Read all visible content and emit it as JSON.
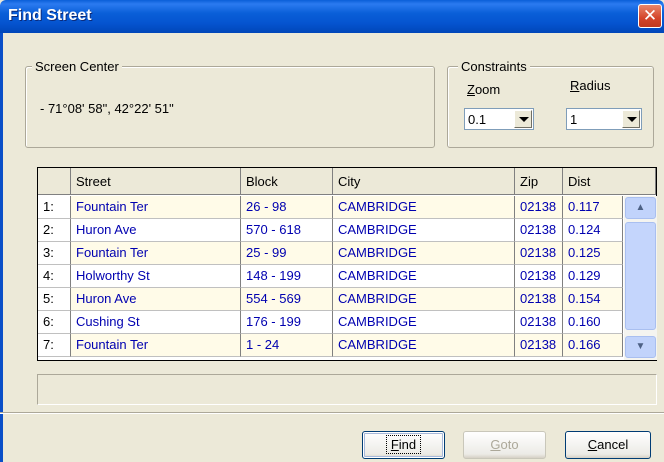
{
  "window": {
    "title": "Find Street",
    "close_glyph": "✕"
  },
  "screen_center": {
    "legend": "Screen Center",
    "coordinates": "- 71°08' 58\",  42°22' 51\""
  },
  "constraints": {
    "legend": "Constraints",
    "zoom": {
      "label_prefix": "Z",
      "label_rest": "oom",
      "value": "0.1"
    },
    "radius": {
      "label_prefix": "R",
      "label_rest": "adius",
      "value": "1"
    }
  },
  "results": {
    "columns": [
      "",
      "Street",
      "Block",
      "City",
      "Zip",
      "Dist"
    ],
    "rows": [
      {
        "idx": "1:",
        "street": "Fountain Ter",
        "block": "26 - 98",
        "city": "CAMBRIDGE",
        "zip": "02138",
        "dist": "0.117"
      },
      {
        "idx": "2:",
        "street": "Huron Ave",
        "block": "570 - 618",
        "city": "CAMBRIDGE",
        "zip": "02138",
        "dist": "0.124"
      },
      {
        "idx": "3:",
        "street": "Fountain Ter",
        "block": "25 - 99",
        "city": "CAMBRIDGE",
        "zip": "02138",
        "dist": "0.125"
      },
      {
        "idx": "4:",
        "street": "Holworthy St",
        "block": "148 - 199",
        "city": "CAMBRIDGE",
        "zip": "02138",
        "dist": "0.129"
      },
      {
        "idx": "5:",
        "street": "Huron Ave",
        "block": "554 - 569",
        "city": "CAMBRIDGE",
        "zip": "02138",
        "dist": "0.154"
      },
      {
        "idx": "6:",
        "street": "Cushing St",
        "block": "176 - 199",
        "city": "CAMBRIDGE",
        "zip": "02138",
        "dist": "0.160"
      },
      {
        "idx": "7:",
        "street": "Fountain Ter",
        "block": "1 - 24",
        "city": "CAMBRIDGE",
        "zip": "02138",
        "dist": "0.166"
      }
    ]
  },
  "buttons": {
    "find": {
      "prefix": "F",
      "rest": "ind"
    },
    "goto": {
      "prefix": "G",
      "rest": "oto"
    },
    "cancel": {
      "prefix": "C",
      "rest": "ancel"
    }
  },
  "colors": {
    "titlebar": "#0a5fd8",
    "row_text": "#0000b0",
    "highlight_row": "#fffbe8"
  },
  "icons": {
    "close": "close-icon",
    "scroll_up": "scroll-up-icon",
    "scroll_down": "scroll-down-icon",
    "dropdown": "chevron-down-icon"
  }
}
